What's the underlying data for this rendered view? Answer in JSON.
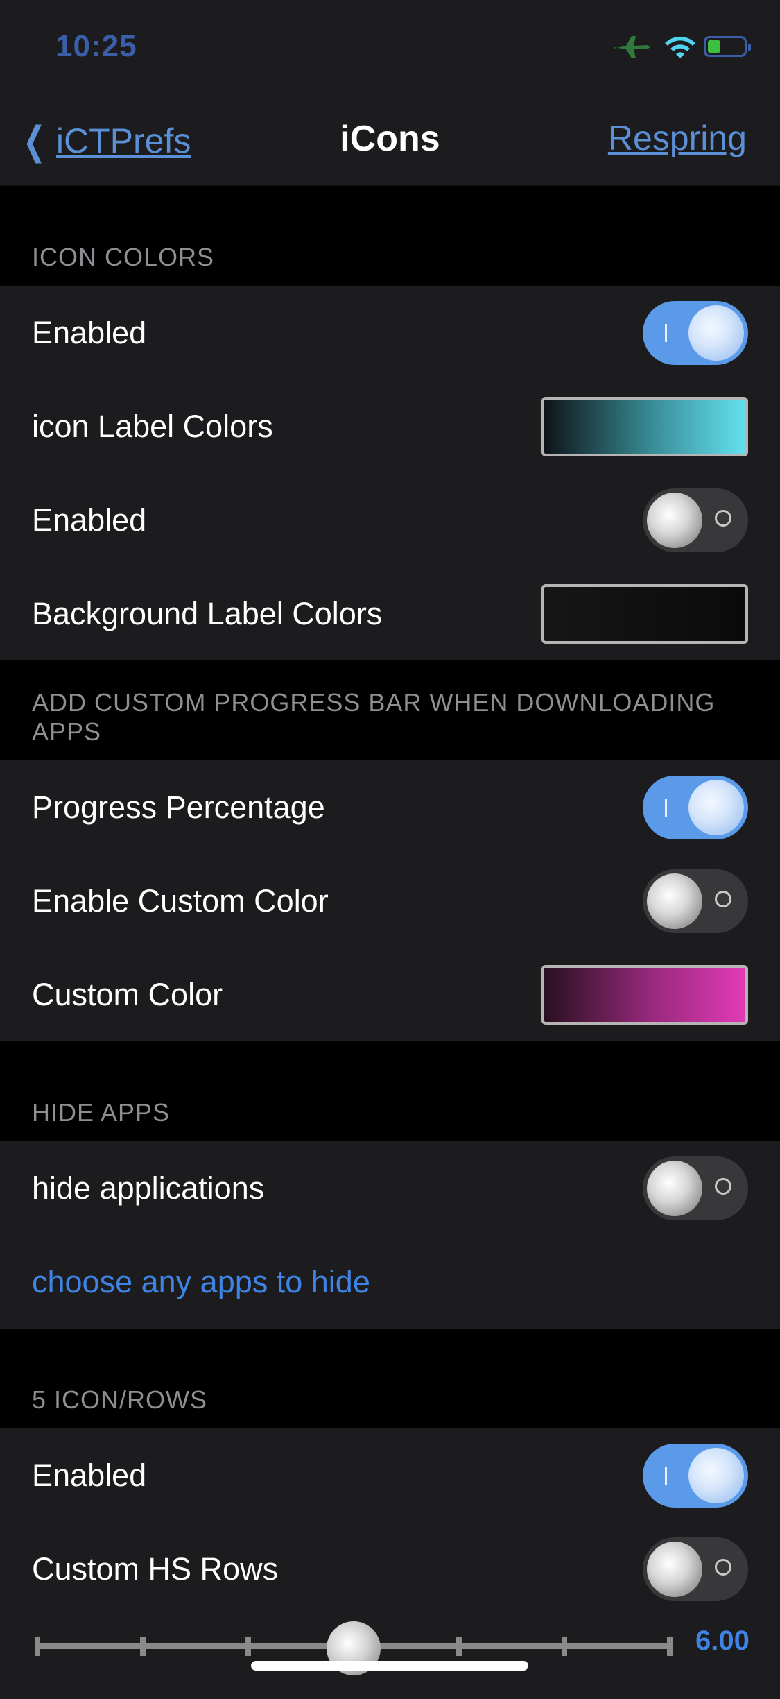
{
  "status_bar": {
    "time": "10:25"
  },
  "nav": {
    "back_label": "iCTPrefs",
    "title": "iCons",
    "action_label": "Respring"
  },
  "sections": {
    "icon_colors": {
      "header": "ICON COLORS",
      "rows": [
        {
          "label": "Enabled",
          "type": "toggle",
          "value": true
        },
        {
          "label": "icon Label Colors",
          "type": "color",
          "color": "#64e0ef"
        },
        {
          "label": "Enabled",
          "type": "toggle",
          "value": false
        },
        {
          "label": "Background Label Colors",
          "type": "color",
          "color": "#0a0a0a"
        }
      ]
    },
    "progress_bar": {
      "header": "ADD CUSTOM PROGRESS BAR WHEN DOWNLOADING APPS",
      "rows": [
        {
          "label": "Progress Percentage",
          "type": "toggle",
          "value": true
        },
        {
          "label": "Enable Custom Color",
          "type": "toggle",
          "value": false
        },
        {
          "label": "Custom Color",
          "type": "color",
          "color": "#e23ab7"
        }
      ]
    },
    "hide_apps": {
      "header": "HIDE APPS",
      "rows": [
        {
          "label": "hide applications",
          "type": "toggle",
          "value": false
        },
        {
          "label": "choose any apps to hide",
          "type": "link"
        }
      ]
    },
    "icon_rows": {
      "header": "5 ICON/ROWS",
      "rows": [
        {
          "label": "Enabled",
          "type": "toggle",
          "value": true
        },
        {
          "label": "Custom HS Rows",
          "type": "toggle",
          "value": false
        }
      ],
      "slider": {
        "value_text": "6.00",
        "ticks": 7,
        "value_index": 3
      }
    }
  },
  "colors": {
    "accent": "#5a9ae8",
    "link": "#3f84e5",
    "group_bg": "#1c1c1e",
    "header_text": "#8e8e93"
  }
}
